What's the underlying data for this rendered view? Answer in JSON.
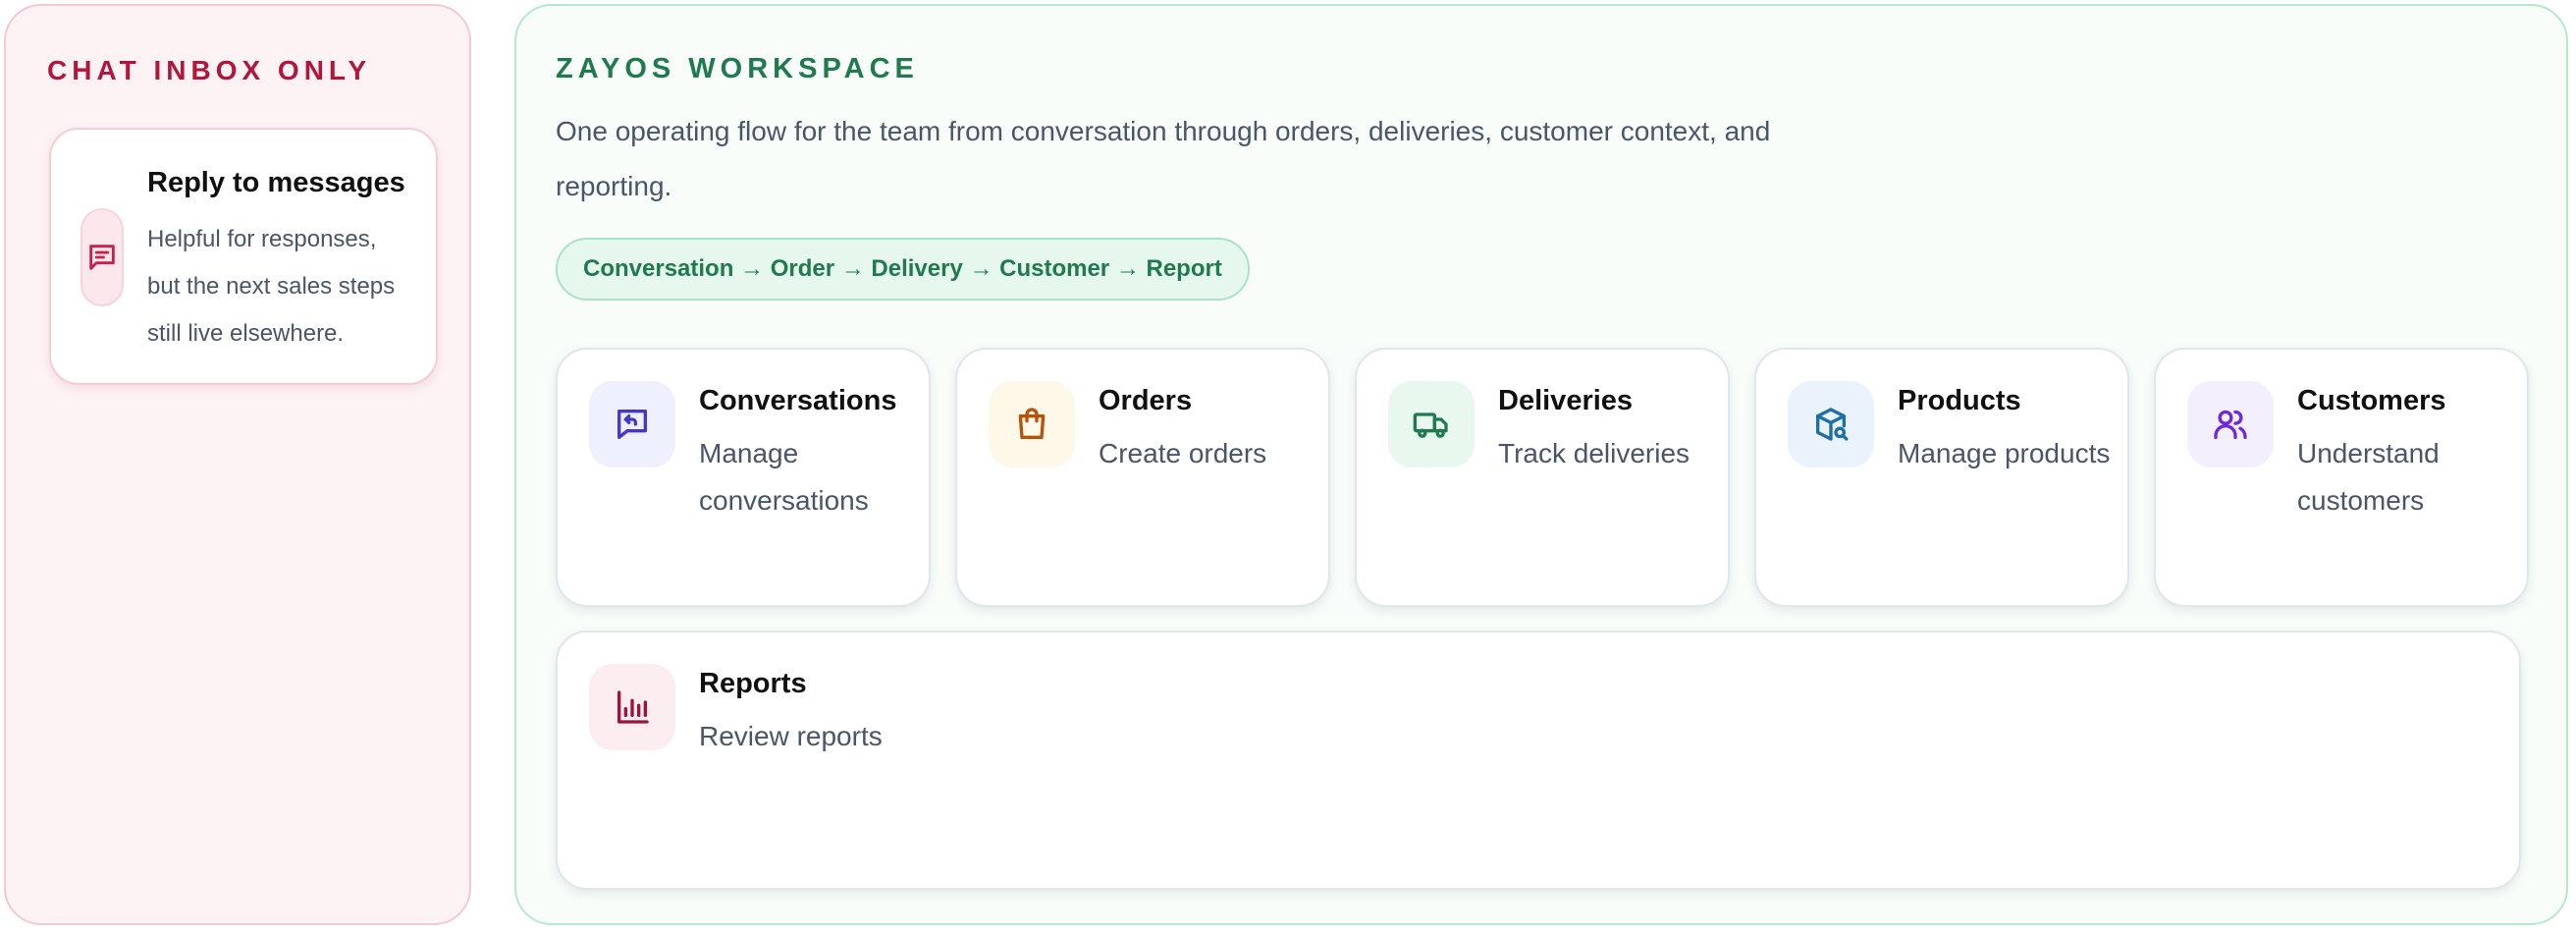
{
  "left_panel": {
    "title": "CHAT INBOX ONLY",
    "card": {
      "icon": "message-square-text-icon",
      "title": "Reply to messages",
      "description": "Helpful for responses, but the next sales steps still live elsewhere."
    }
  },
  "workspace": {
    "title": "ZAYOS WORKSPACE",
    "description": "One operating flow for the team from conversation through orders, deliveries, customer context, and reporting.",
    "flow": "Conversation → Order → Delivery → Customer → Report",
    "modules": [
      {
        "title": "Conversations",
        "description": "Manage conversations",
        "icon": "message-reply-icon",
        "color": "#4338ca",
        "bg": "#eef0fd"
      },
      {
        "title": "Orders",
        "description": "Create orders",
        "icon": "shopping-bag-icon",
        "color": "#b45309",
        "bg": "#fdf8e8"
      },
      {
        "title": "Deliveries",
        "description": "Track deliveries",
        "icon": "truck-icon",
        "color": "#1f7a4e",
        "bg": "#e9f8ef"
      },
      {
        "title": "Products",
        "description": "Manage products",
        "icon": "package-search-icon",
        "color": "#1d6fa5",
        "bg": "#eaf3fc"
      },
      {
        "title": "Customers",
        "description": "Understand customers",
        "icon": "users-icon",
        "color": "#6d28d9",
        "bg": "#f3effd"
      },
      {
        "title": "Reports",
        "description": "Review reports",
        "icon": "bar-chart-icon",
        "color": "#9f1239",
        "bg": "#fcedf0"
      }
    ]
  }
}
